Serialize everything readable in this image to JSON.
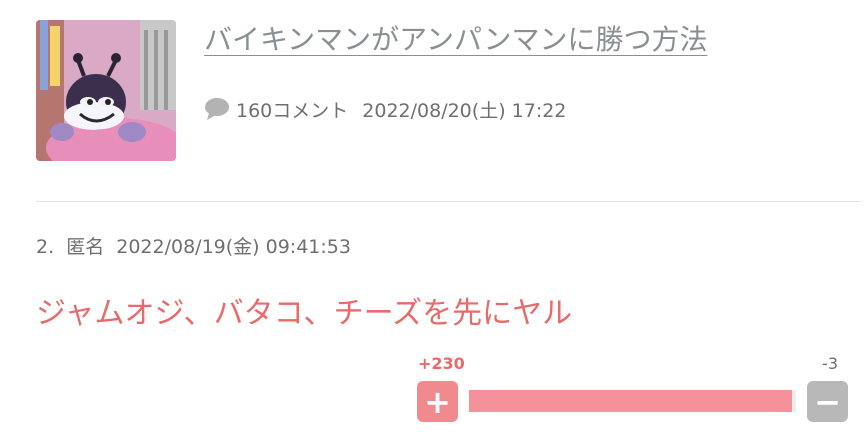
{
  "thread": {
    "title": "バイキンマンがアンパンマンに勝つ方法",
    "comment_count": "160コメント",
    "posted_at": "2022/08/20(土) 17:22"
  },
  "response": {
    "number": "2.",
    "author": "匿名",
    "posted_at": "2022/08/19(金) 09:41:53",
    "body": "ジャムオジ、バタコ、チーズを先にヤル"
  },
  "votes": {
    "plus_count": "+230",
    "minus_count": "-3",
    "plus_label": "+",
    "minus_label": "−",
    "plus_share": 0.987
  },
  "colors": {
    "accent": "#e86a6a",
    "bar": "#f4919a",
    "plus_button": "#f08a8f",
    "minus_button": "#b8b8b8"
  },
  "icons": {
    "comment": "speech-bubble-icon",
    "thumbnail": "baikinman-figure-photo"
  }
}
